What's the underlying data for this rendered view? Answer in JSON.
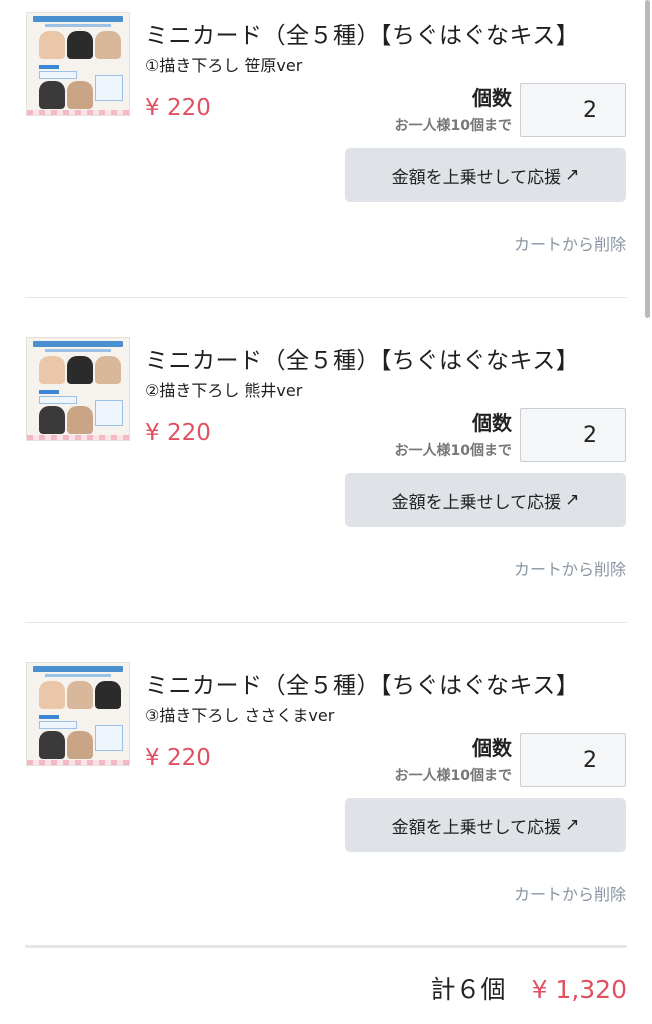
{
  "items": [
    {
      "title": "ミニカード（全５種）【ちぐはぐなキス】",
      "variant": "①描き下ろし 笹原ver",
      "price": "¥ 220",
      "quantity_label": "個数",
      "quantity_limit": "お一人様10個まで",
      "quantity": "2",
      "support_button": "金額を上乗せして応援",
      "remove_link": "カートから削除"
    },
    {
      "title": "ミニカード（全５種）【ちぐはぐなキス】",
      "variant": "②描き下ろし 熊井ver",
      "price": "¥ 220",
      "quantity_label": "個数",
      "quantity_limit": "お一人様10個まで",
      "quantity": "2",
      "support_button": "金額を上乗せして応援",
      "remove_link": "カートから削除"
    },
    {
      "title": "ミニカード（全５種）【ちぐはぐなキス】",
      "variant": "③描き下ろし ささくまver",
      "price": "¥ 220",
      "quantity_label": "個数",
      "quantity_limit": "お一人様10個まで",
      "quantity": "2",
      "support_button": "金額を上乗せして応援",
      "remove_link": "カートから削除"
    }
  ],
  "icons": {
    "external_link": "arrow-up-right-icon"
  },
  "total": {
    "count": "計６個",
    "amount": "¥ 1,320"
  },
  "colors": {
    "price": "#e05060",
    "button_bg": "#dfe2e7",
    "link": "#8a95a3"
  }
}
